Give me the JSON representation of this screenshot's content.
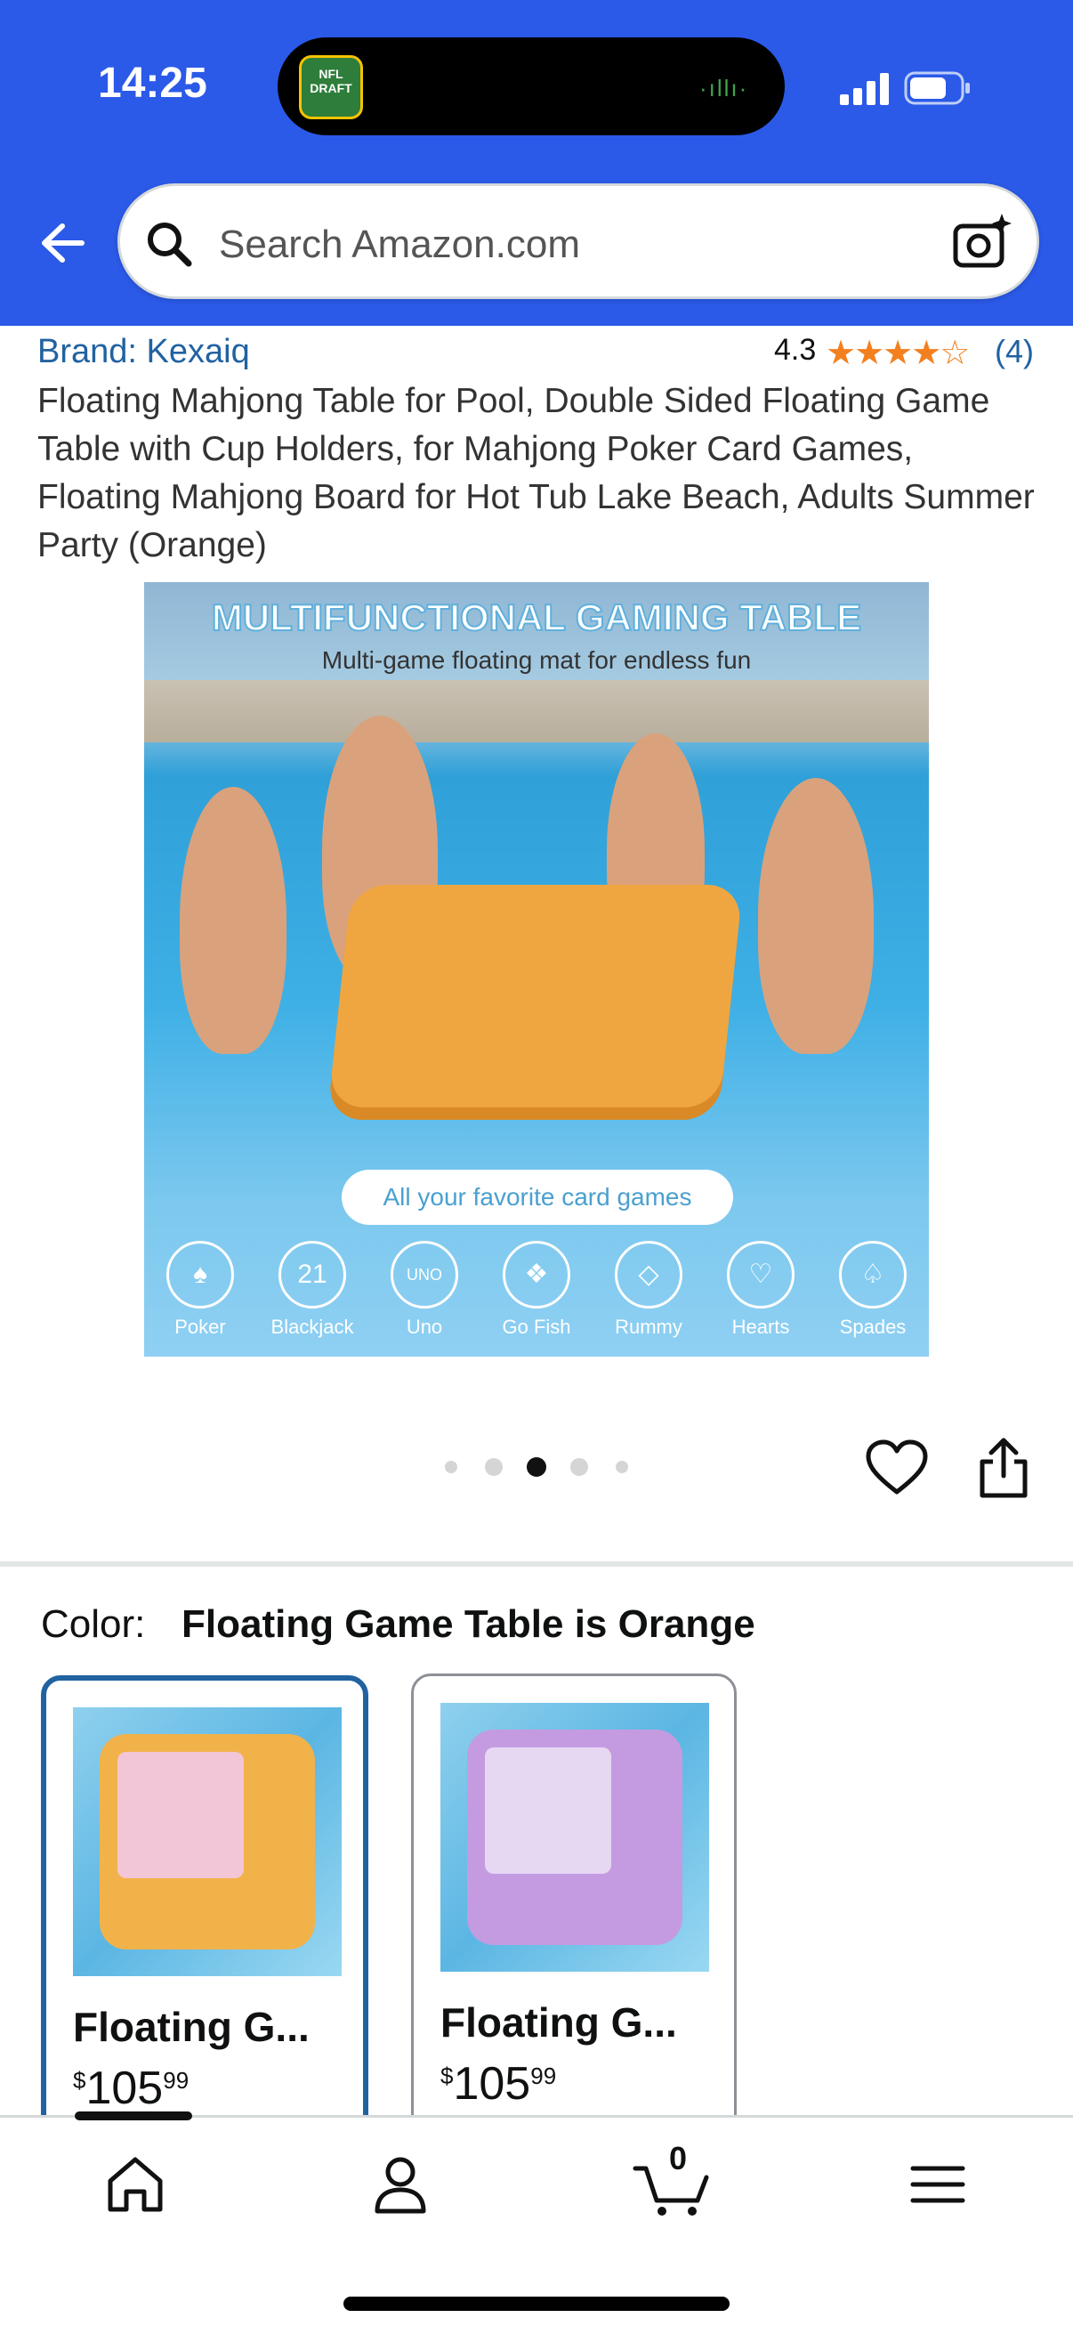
{
  "status_bar": {
    "time": "14:25",
    "island_app_badge": "NFL DRAFT"
  },
  "search": {
    "placeholder": "Search Amazon.com"
  },
  "product": {
    "brand": "Brand: Kexaiq",
    "rating_value": "4.3",
    "rating_stars": "★★★★☆",
    "rating_count": "(4)",
    "title": "Floating Mahjong Table for Pool, Double Sided Floating Game Table with Cup Holders, for Mahjong Poker Card Games, Floating Mahjong Board for Hot Tub Lake Beach, Adults Summer Party (Orange)"
  },
  "image": {
    "headline": "MULTIFUNCTIONAL GAMING TABLE",
    "subtitle": "Multi-game floating mat for endless fun",
    "caption": "All your favorite card games",
    "games": [
      {
        "label": "Poker",
        "glyph": "♠"
      },
      {
        "label": "Blackjack",
        "glyph": "21"
      },
      {
        "label": "Uno",
        "glyph": "UNO"
      },
      {
        "label": "Go Fish",
        "glyph": "❖"
      },
      {
        "label": "Rummy",
        "glyph": "◇"
      },
      {
        "label": "Hearts",
        "glyph": "♡"
      },
      {
        "label": "Spades",
        "glyph": "♤"
      }
    ],
    "carousel_total": 5,
    "carousel_active_index": 2
  },
  "variation": {
    "color_label": "Color:",
    "color_value": "Floating Game Table is Orange",
    "options": [
      {
        "name": "Floating G...",
        "price_symbol": "$",
        "price_whole": "105",
        "price_fraction": "99",
        "selected": true,
        "board_color": "#f2b24a",
        "inner_color": "#f2c6d6"
      },
      {
        "name": "Floating G...",
        "price_symbol": "$",
        "price_whole": "105",
        "price_fraction": "99",
        "selected": false,
        "board_color": "#c49be0",
        "inner_color": "#e6d7f3"
      }
    ]
  },
  "bottom_nav": {
    "cart_count": "0",
    "items": [
      "home-icon",
      "account-icon",
      "cart-icon",
      "menu-icon"
    ]
  },
  "colors": {
    "header_bg": "#2b5ae8",
    "link": "#2162a1",
    "star": "#f3801e",
    "selected_border": "#2162a1"
  }
}
